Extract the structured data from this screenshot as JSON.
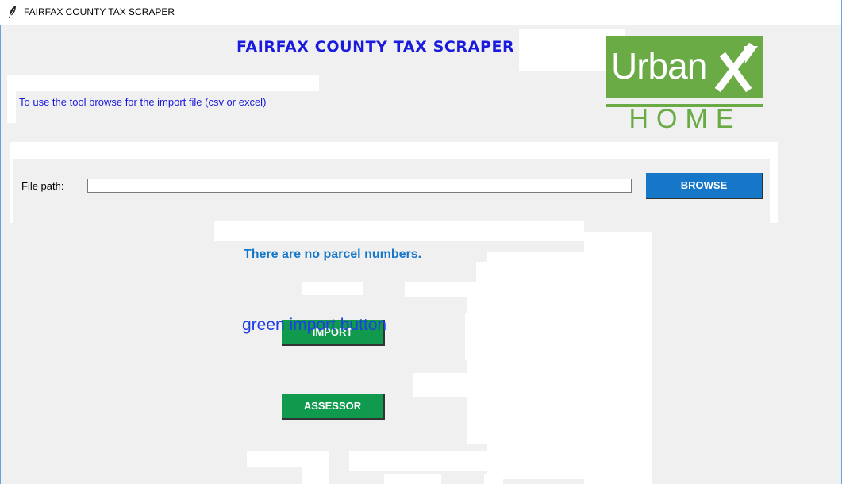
{
  "window": {
    "title": "FAIRFAX COUNTY TAX SCRAPER",
    "icon": "feather-icon"
  },
  "header": {
    "app_title": "FAIRFAX COUNTY TAX SCRAPER",
    "instruction": "To use the tool browse for the import file (csv or excel)"
  },
  "logo": {
    "word_top": "Urban",
    "word_bottom": "HOME",
    "color": "#6aab45"
  },
  "file_row": {
    "label": "File path:",
    "value": "",
    "browse_label": "BROWSE"
  },
  "status": {
    "message": "There are no parcel numbers."
  },
  "actions": {
    "import_label": "IMPORT",
    "assessor_label": "ASSESSOR",
    "overlay_caption": "green import button"
  },
  "colors": {
    "title_blue": "#1a1adc",
    "browse_blue": "#1677c9",
    "action_green": "#0f9a4e"
  }
}
